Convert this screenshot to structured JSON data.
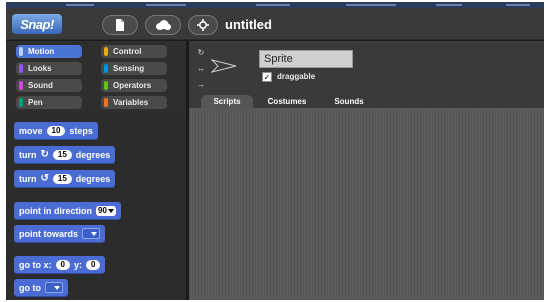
{
  "app": {
    "logo_text": "Snap!",
    "project_title": "untitled"
  },
  "toolbar": {
    "buttons": [
      "file-icon",
      "cloud-icon",
      "settings-icon"
    ]
  },
  "categories": [
    {
      "label": "Motion",
      "color": "#4a6cd4",
      "selected": true
    },
    {
      "label": "Control",
      "color": "#e6a822",
      "selected": false
    },
    {
      "label": "Looks",
      "color": "#8f56e3",
      "selected": false
    },
    {
      "label": "Sensing",
      "color": "#0494dc",
      "selected": false
    },
    {
      "label": "Sound",
      "color": "#cf4ad9",
      "selected": false
    },
    {
      "label": "Operators",
      "color": "#62c213",
      "selected": false
    },
    {
      "label": "Pen",
      "color": "#00a178",
      "selected": false
    },
    {
      "label": "Variables",
      "color": "#f3761d",
      "selected": false
    }
  ],
  "blocks": {
    "move": {
      "pre": "move",
      "value": "10",
      "post": "steps"
    },
    "turn_cw": {
      "pre": "turn",
      "icon": "↻",
      "value": "15",
      "post": "degrees"
    },
    "turn_ccw": {
      "pre": "turn",
      "icon": "↺",
      "value": "15",
      "post": "degrees"
    },
    "point_direction": {
      "pre": "point in direction",
      "value": "90"
    },
    "point_towards": {
      "pre": "point towards"
    },
    "go_to_xy": {
      "pre": "go to x:",
      "x": "0",
      "mid": "y:",
      "y": "0"
    },
    "go_to": {
      "pre": "go to"
    }
  },
  "sprite": {
    "name": "Sprite",
    "draggable_label": "draggable",
    "draggable_checked": "✓",
    "rotation_buttons": [
      "rotate-icon",
      "flip-icon",
      "no-rotate-icon"
    ]
  },
  "tabs": [
    {
      "label": "Scripts",
      "active": true
    },
    {
      "label": "Costumes",
      "active": false
    },
    {
      "label": "Sounds",
      "active": false
    }
  ]
}
